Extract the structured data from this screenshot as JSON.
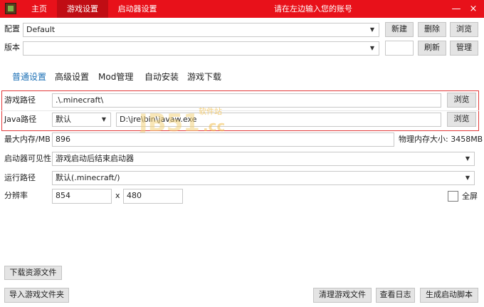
{
  "titlebar": {
    "tabs": [
      {
        "label": "主页"
      },
      {
        "label": "游戏设置"
      },
      {
        "label": "启动器设置"
      }
    ],
    "title": "请在左边输入您的账号",
    "min_symbol": "—",
    "close_symbol": "×",
    "icon": "minecraft-grass-block-icon"
  },
  "config": {
    "label": "配置",
    "value": "Default",
    "new_label": "新建",
    "delete_label": "删除",
    "browse_label": "浏览"
  },
  "version": {
    "label": "版本",
    "value": "",
    "small_value": "",
    "refresh_label": "刷新",
    "manage_label": "管理"
  },
  "subtabs": [
    {
      "label": "普通设置"
    },
    {
      "label": "高级设置"
    },
    {
      "label": "Mod管理"
    },
    {
      "label": "自动安装"
    },
    {
      "label": "游戏下载"
    }
  ],
  "game_path": {
    "label": "游戏路径",
    "value": ".\\.minecraft\\",
    "browse_label": "浏览"
  },
  "java_path": {
    "label": "Java路径",
    "mode": "默认",
    "value": "D:\\jre\\bin\\javaw.exe",
    "browse_label": "浏览"
  },
  "memory": {
    "label": "最大内存/MB",
    "value": "896",
    "physical_label": "物理内存大小: 3458MB"
  },
  "launcher_visibility": {
    "label": "启动器可见性",
    "value": "游戏启动后结束启动器"
  },
  "run_path": {
    "label": "运行路径",
    "value": "默认(.minecraft/)"
  },
  "resolution": {
    "label": "分辨率",
    "width": "854",
    "x_sep": "x",
    "height": "480",
    "fullscreen_label": "全屏",
    "fullscreen_checked": false
  },
  "bottom": {
    "download_resources_label": "下载资源文件",
    "import_folder_label": "导入游戏文件夹",
    "clean_label": "清理游戏文件",
    "log_label": "查看日志",
    "script_label": "生成启动脚本"
  },
  "watermark": {
    "brand": "JB51",
    "sub": "软件站",
    "domain": ".cc"
  },
  "colors": {
    "accent_red": "#e8111a",
    "active_tab_red": "#c00d14",
    "subtab_active_blue": "#1a6fb5"
  }
}
